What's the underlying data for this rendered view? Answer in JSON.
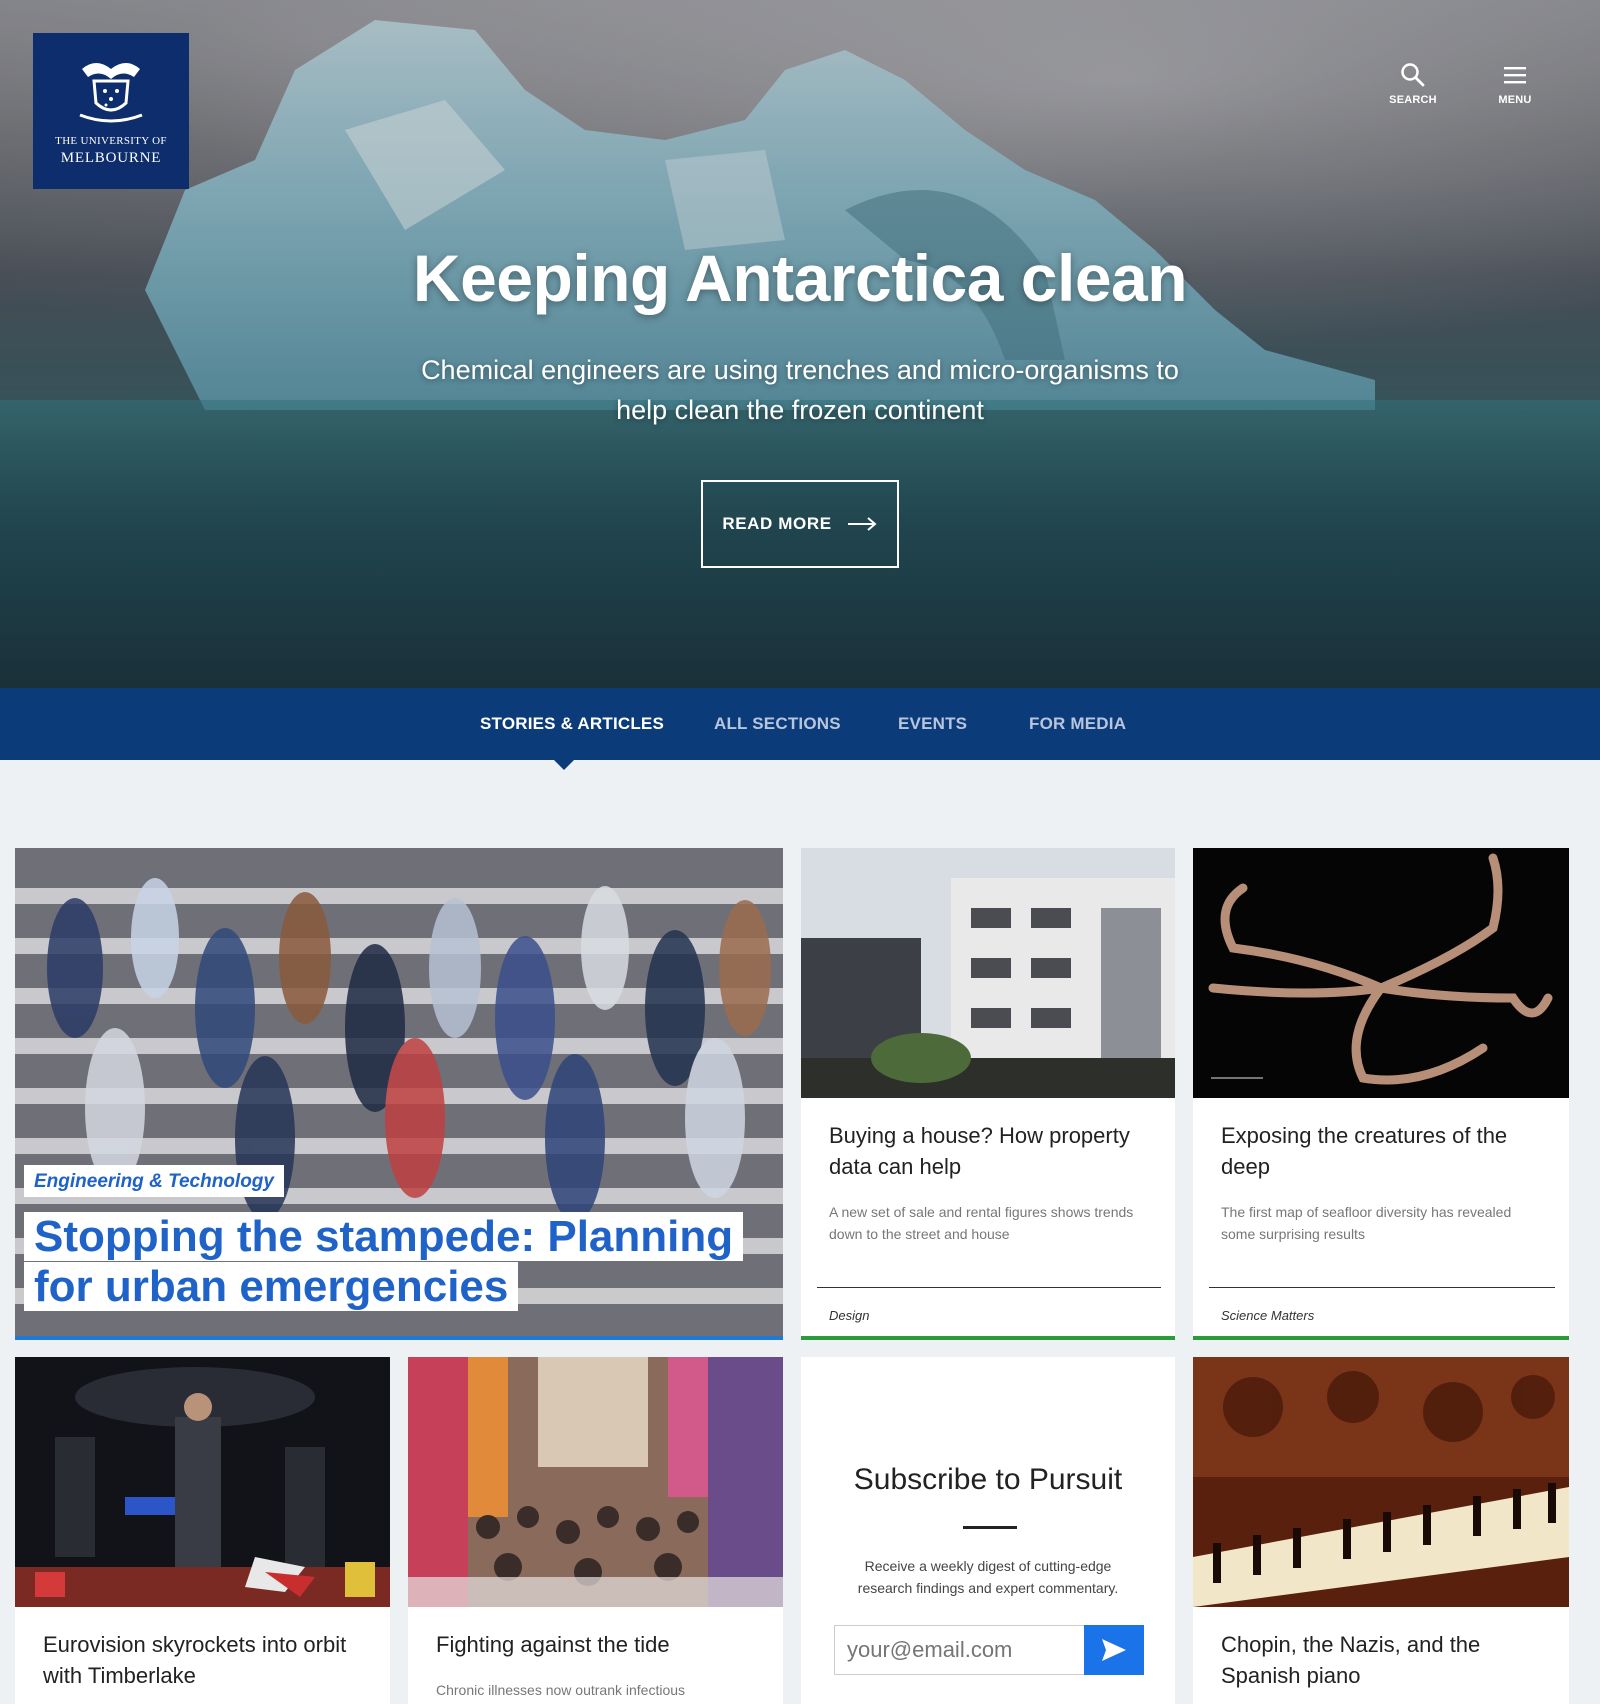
{
  "header": {
    "logo_line1": "THE UNIVERSITY OF",
    "logo_line2": "MELBOURNE",
    "search_label": "SEARCH",
    "menu_label": "MENU"
  },
  "hero": {
    "title": "Keeping Antarctica clean",
    "subtitle": "Chemical engineers are using trenches and micro-organisms to help clean the frozen continent",
    "button_label": "READ MORE"
  },
  "nav": {
    "items": [
      "STORIES & ARTICLES",
      "ALL SECTIONS",
      "EVENTS",
      "FOR MEDIA"
    ],
    "active": "STORIES & ARTICLES"
  },
  "featured": {
    "category": "Engineering & Technology",
    "title_line1": "Stopping the stampede: Planning",
    "title_line2": "for urban emergencies"
  },
  "cards": [
    {
      "title": "Buying a house? How property data can help",
      "description": "A new set of sale and rental figures shows trends down to the street and house",
      "category": "Design"
    },
    {
      "title": "Exposing the creatures of the deep",
      "description": "The first map of seafloor diversity has revealed some surprising results",
      "category": "Science Matters"
    },
    {
      "title": "Eurovision skyrockets into orbit with Timberlake"
    },
    {
      "title": "Fighting against the tide",
      "description": "Chronic illnesses now outrank infectious"
    },
    {
      "title": "Chopin, the Nazis, and the Spanish piano"
    }
  ],
  "subscribe": {
    "title": "Subscribe to Pursuit",
    "description": "Receive a weekly digest of cutting-edge research findings and expert commentary.",
    "email_placeholder": "your@email.com"
  },
  "colors": {
    "brand_navy": "#0d2d6c",
    "nav_blue": "#0c3b7a",
    "accent_blue": "#1f62c8",
    "card_bar_green": "#2a9a3a",
    "submit_blue": "#1a73e8"
  }
}
